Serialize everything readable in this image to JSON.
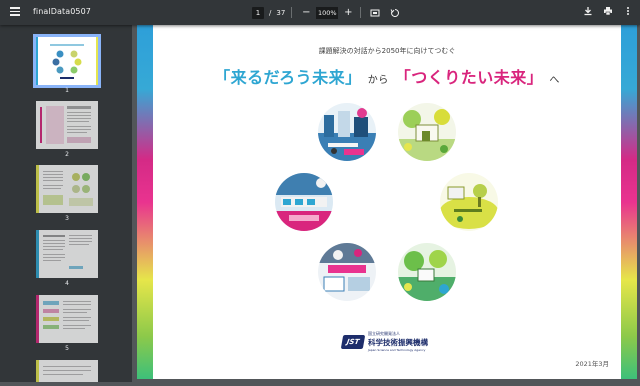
{
  "toolbar": {
    "title": "finalData0507",
    "page_current": "1",
    "page_total": "37",
    "zoom": "100%",
    "icons": [
      "menu-icon",
      "minus-icon",
      "plus-icon",
      "fit-page-icon",
      "rotate-icon",
      "download-icon",
      "print-icon",
      "more-icon"
    ]
  },
  "sidebar": {
    "thumbnails": [
      {
        "number": "1"
      },
      {
        "number": "2"
      },
      {
        "number": "3"
      },
      {
        "number": "4"
      },
      {
        "number": "5"
      }
    ]
  },
  "document": {
    "subtitle": "課題解決の対話から2050年に向けてつむぐ",
    "headline_part1": "「来るだろう未来」",
    "headline_mid": "から",
    "headline_part2": "「つくりたい未来」",
    "headline_end": "へ",
    "org_small": "国立研究開発法人",
    "org_name": "科学技術振興機構",
    "org_en": "Japan Science and Technology Agency",
    "logo_mark": "JST",
    "date": "2021年3月"
  },
  "colors": {
    "accent_blue": "#2ea6d2",
    "accent_pink": "#d9257d",
    "toolbar_bg": "#323639",
    "viewer_bg": "#525659"
  }
}
